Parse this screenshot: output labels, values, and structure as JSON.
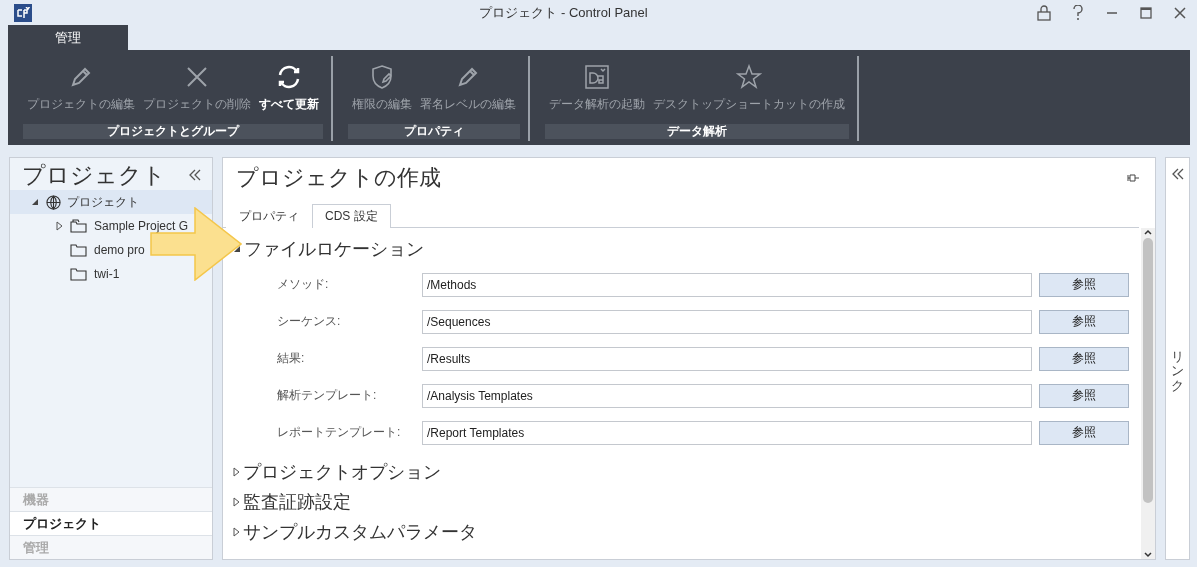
{
  "window": {
    "title": "プロジェクト - Control Panel"
  },
  "ribbon_tabs": [
    {
      "label": "管理",
      "selected": true
    }
  ],
  "ribbon_groups": [
    {
      "label": "プロジェクトとグループ",
      "buttons": [
        {
          "label": "プロジェクトの編集",
          "disabled": true
        },
        {
          "label": "プロジェクトの削除",
          "disabled": true
        },
        {
          "label": "すべて更新",
          "disabled": false
        }
      ]
    },
    {
      "label": "プロパティ",
      "buttons": [
        {
          "label": "権限の編集",
          "disabled": true
        },
        {
          "label": "署名レベルの編集",
          "disabled": true
        }
      ]
    },
    {
      "label": "データ解析",
      "buttons": [
        {
          "label": "データ解析の起動",
          "disabled": true
        },
        {
          "label": "デスクトップショートカットの作成",
          "disabled": true
        }
      ]
    }
  ],
  "sidebar": {
    "title": "プロジェクト",
    "tree": [
      {
        "label": "プロジェクト",
        "expanded": true,
        "selected": true,
        "children": [
          {
            "label": "Sample Project G",
            "expanded": false,
            "selected": false
          },
          {
            "label": "demo pro",
            "selected": false
          },
          {
            "label": "twi-1",
            "selected": false
          }
        ]
      }
    ],
    "nav": [
      {
        "label": "機器",
        "selected": false
      },
      {
        "label": "プロジェクト",
        "selected": true
      },
      {
        "label": "管理",
        "selected": false
      }
    ]
  },
  "content": {
    "title": "プロジェクトの作成",
    "tabs": [
      {
        "label": "プロパティ",
        "selected": false
      },
      {
        "label": "CDS 設定",
        "selected": true
      }
    ],
    "sections": [
      {
        "title": "ファイルロケーション",
        "expanded": true,
        "fields": [
          {
            "label": "メソッド:",
            "value": "/Methods",
            "button": "参照"
          },
          {
            "label": "シーケンス:",
            "value": "/Sequences",
            "button": "参照"
          },
          {
            "label": "結果:",
            "value": "/Results",
            "button": "参照"
          },
          {
            "label": "解析テンプレート:",
            "value": "/Analysis Templates",
            "button": "参照"
          },
          {
            "label": "レポートテンプレート:",
            "value": "/Report Templates",
            "button": "参照"
          }
        ]
      },
      {
        "title": "プロジェクトオプション",
        "expanded": false
      },
      {
        "title": "監査証跡設定",
        "expanded": false
      },
      {
        "title": "サンプルカスタムパラメータ",
        "expanded": false
      }
    ]
  },
  "right_panel": {
    "label": "リンク"
  }
}
